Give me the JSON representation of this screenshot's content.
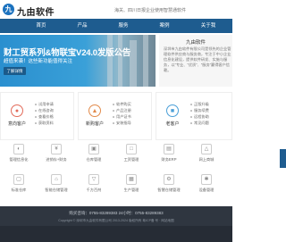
{
  "header": {
    "logo_glyph": "九",
    "logo_text": "九由软件",
    "search_placeholder": "海关、四川日报企业使用智慧通软件"
  },
  "nav": [
    "首页",
    "产品",
    "服务",
    "案例",
    "关于我"
  ],
  "banner": {
    "title": "财工贸系列&物联宝V24.0发版公告",
    "subtitle": "超值来袭！这些新功能值得关注",
    "button": "了解详情"
  },
  "about": {
    "title": "九由软件",
    "body": "深圳市九由软件有限公司是领先的企业管理软件供应商与服务商，专注于中小企业信息化建设，提供软件研发、实施与服务，以“专业、“优质”、“服务”赢得客户信赖。"
  },
  "roles": [
    {
      "name": "意向客户",
      "icon": "user-icon",
      "color": "#e26b5a",
      "items": [
        "试用申请",
        "在线咨询",
        "查看价格",
        "获取资料"
      ]
    },
    {
      "name": "新购客户",
      "icon": "cart-icon",
      "color": "#e28a4a",
      "items": [
        "软件购买",
        "产品注册",
        "用户证书",
        "安装指导"
      ]
    },
    {
      "name": "老客户",
      "icon": "person-icon",
      "color": "#4a9fd8",
      "items": [
        "正版升级",
        "服务续费",
        "远程协助",
        "常见问题"
      ]
    }
  ],
  "modules": [
    {
      "label": "管理信息化",
      "icon": "pie-icon",
      "color": "#e2a04a"
    },
    {
      "label": "进销存+财务",
      "icon": "yen-icon",
      "color": "#6fb36f"
    },
    {
      "label": "仓库管理",
      "icon": "folder-icon",
      "color": "#e26b5a"
    },
    {
      "label": "工资管理",
      "icon": "money-icon",
      "color": "#e2a04a"
    },
    {
      "label": "财务ERP",
      "icon": "chart-icon",
      "color": "#4a9fd8"
    },
    {
      "label": "网上商城",
      "icon": "cart-icon",
      "color": "#e28a4a"
    },
    {
      "label": "标准仓库",
      "icon": "box-icon",
      "color": "#6fb36f"
    },
    {
      "label": "智能仓储管理",
      "icon": "warehouse-icon",
      "color": "#4a9fd8"
    },
    {
      "label": "千方百剂",
      "icon": "flask-icon",
      "color": "#e26b5a"
    },
    {
      "label": "生产管理",
      "icon": "factory-icon",
      "color": "#e2a04a"
    },
    {
      "label": "智慧仓储管理",
      "icon": "gear-icon",
      "color": "#6fb36f"
    },
    {
      "label": "设备管理",
      "icon": "tool-icon",
      "color": "#4a9fd8"
    }
  ],
  "footer": {
    "line1": "购买咨询：0755-83289383   24小时：0755-83289383",
    "line2": "Copyright © 深圳市九由软件有限公司 2013-2024 版权所有 粤ICP备  号 · 网站地图"
  }
}
